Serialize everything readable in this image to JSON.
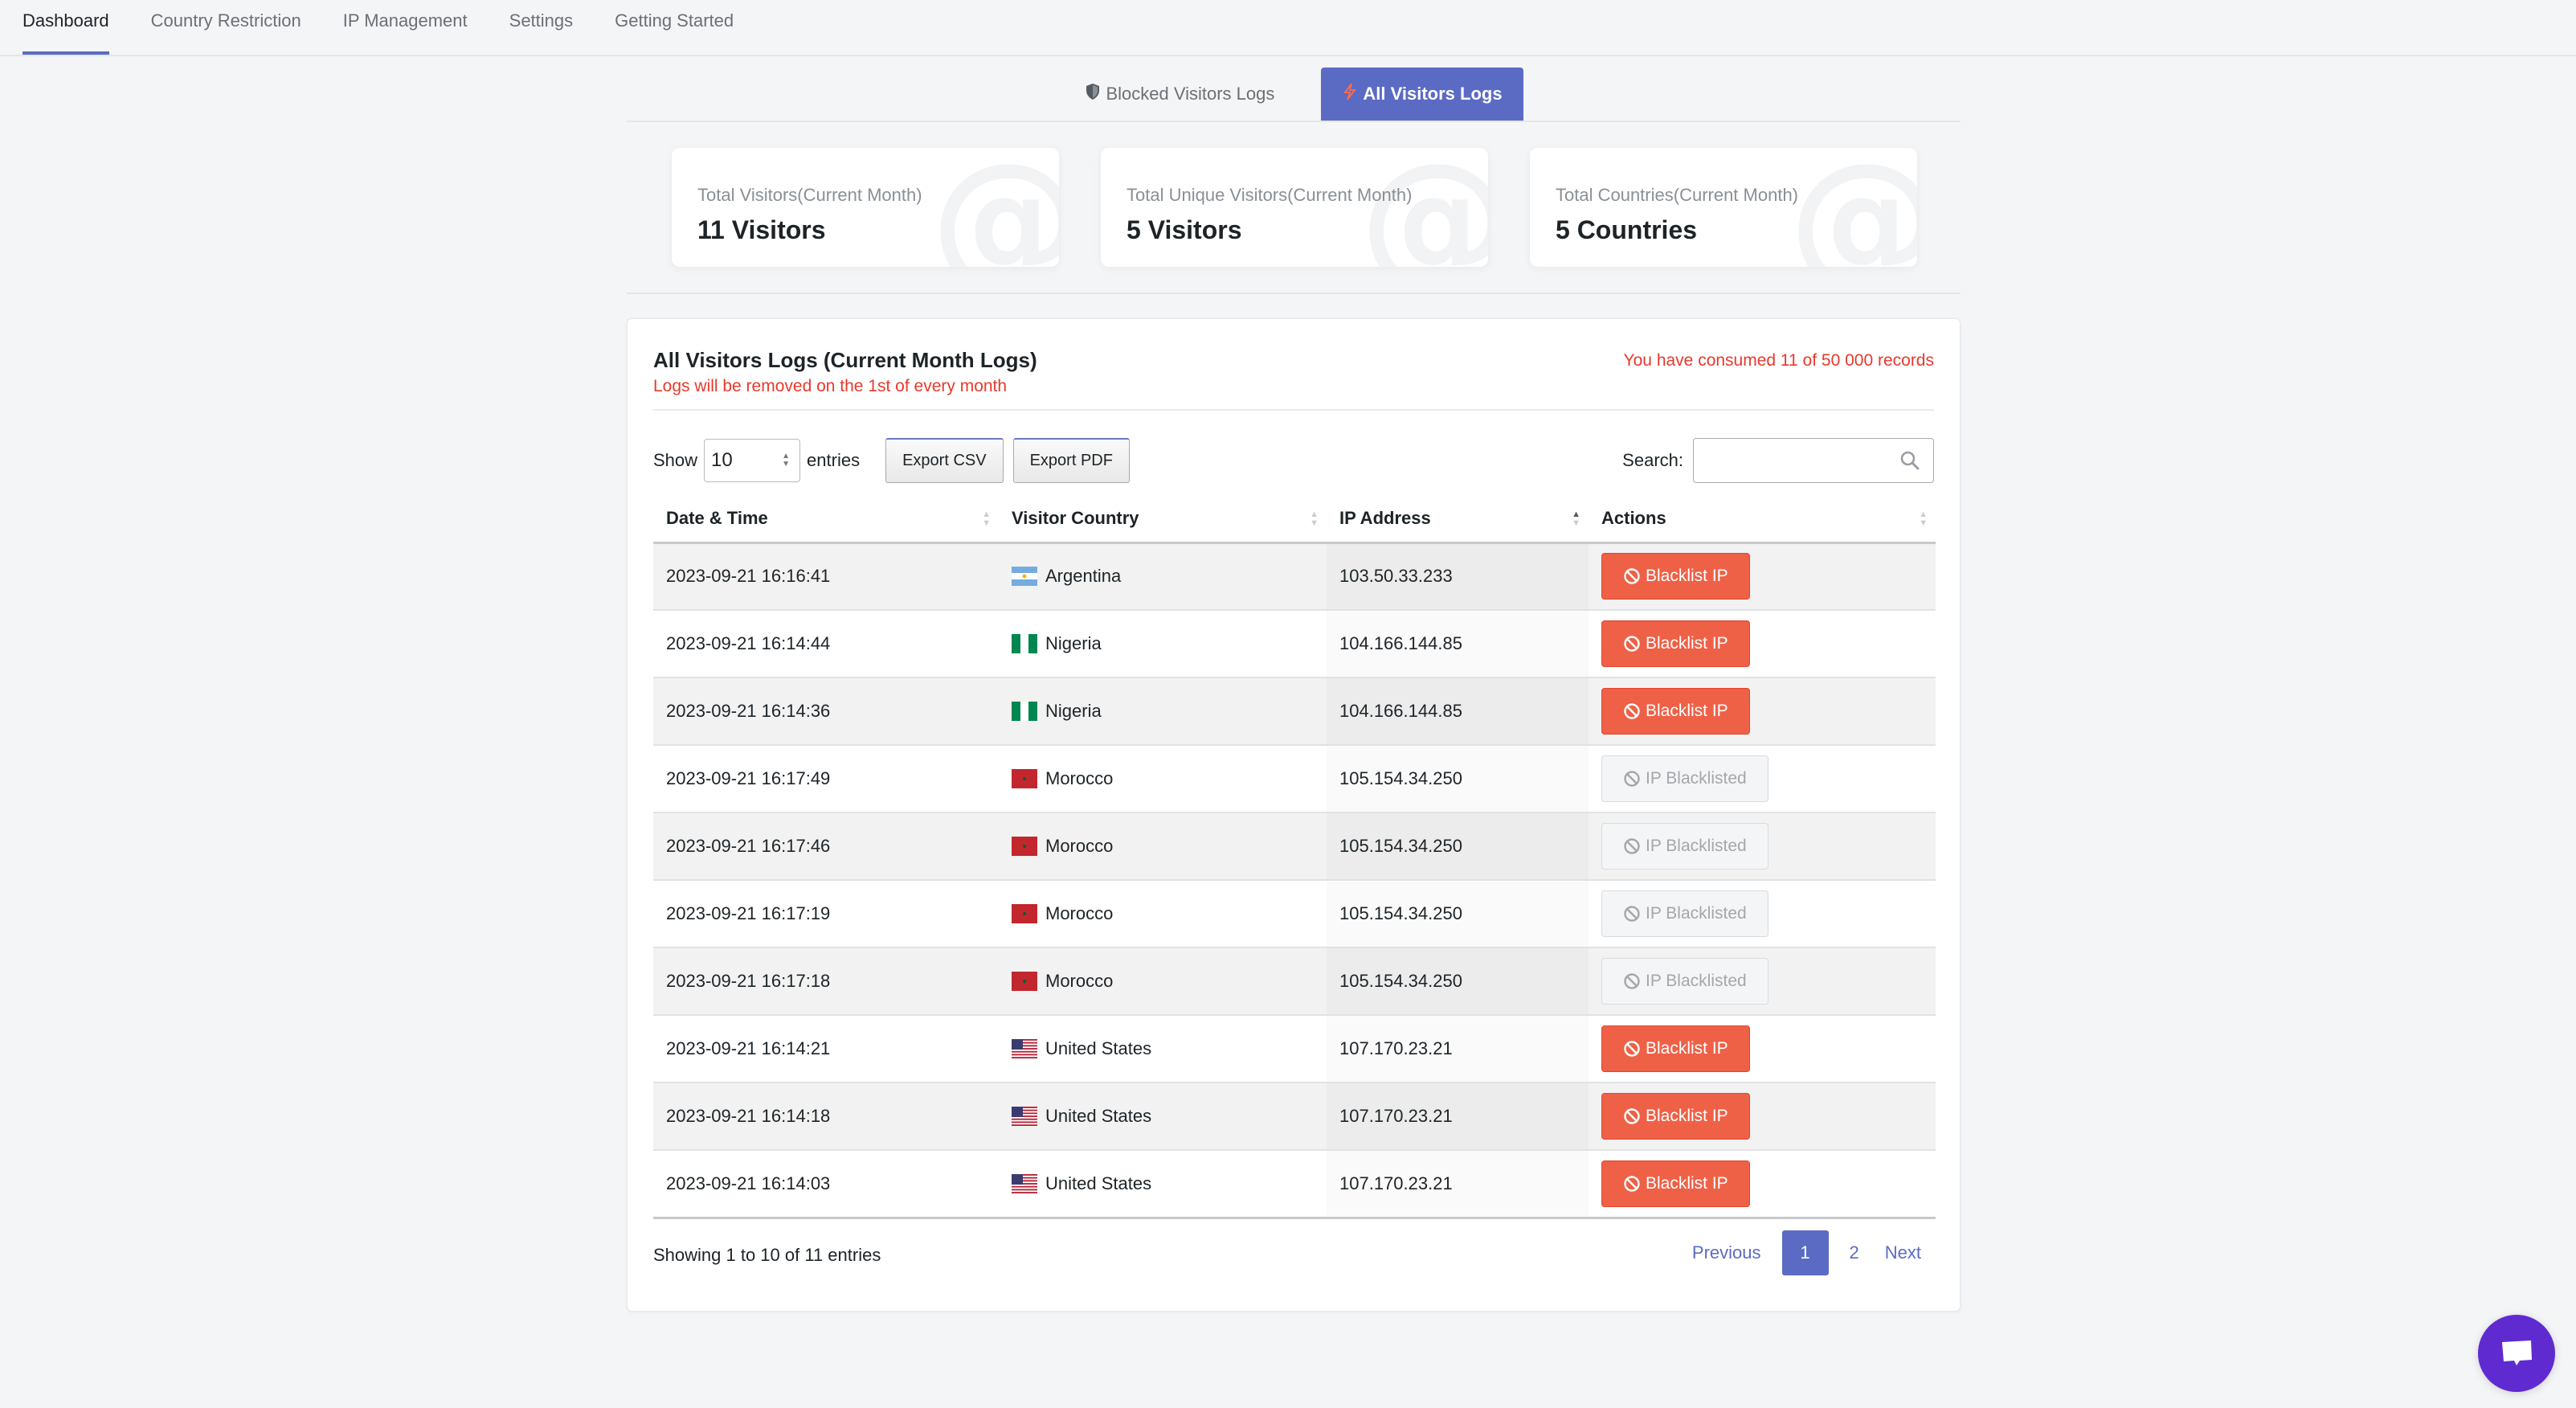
{
  "nav": {
    "items": [
      {
        "label": "Dashboard",
        "active": true
      },
      {
        "label": "Country Restriction",
        "active": false
      },
      {
        "label": "IP Management",
        "active": false
      },
      {
        "label": "Settings",
        "active": false
      },
      {
        "label": "Getting Started",
        "active": false
      }
    ]
  },
  "subtabs": {
    "blocked": {
      "label": "Blocked Visitors Logs",
      "icon": "shield-icon"
    },
    "all": {
      "label": "All Visitors Logs",
      "icon": "bolt-icon",
      "active": true
    }
  },
  "stats": [
    {
      "label": "Total Visitors(Current Month)",
      "value": "11 Visitors",
      "icon": "at-icon"
    },
    {
      "label": "Total Unique Visitors(Current Month)",
      "value": "5 Visitors",
      "icon": "at-icon"
    },
    {
      "label": "Total Countries(Current Month)",
      "value": "5 Countries",
      "icon": "at-icon"
    }
  ],
  "panel": {
    "title": "All Visitors Logs (Current Month Logs)",
    "subtitle": "Logs will be removed on the 1st of every month",
    "consumed": "You have consumed 11 of 50 000 records",
    "show_label": "Show",
    "entries_label": "entries",
    "page_length": "10",
    "export_csv": "Export CSV",
    "export_pdf": "Export PDF",
    "search_label": "Search:",
    "search_value": "",
    "colors": {
      "accent": "#5b6bc4",
      "danger": "#ee6147",
      "warning_text": "#e8392b"
    }
  },
  "table": {
    "columns": [
      {
        "label": "Date & Time",
        "sort": "none"
      },
      {
        "label": "Visitor Country",
        "sort": "none"
      },
      {
        "label": "IP Address",
        "sort": "asc"
      },
      {
        "label": "Actions",
        "sort": "none"
      }
    ],
    "rows": [
      {
        "datetime": "2023-09-21 16:16:41",
        "country": "Argentina",
        "flag": "ar",
        "ip": "103.50.33.233",
        "action": "Blacklist IP",
        "blacklisted": false
      },
      {
        "datetime": "2023-09-21 16:14:44",
        "country": "Nigeria",
        "flag": "ng",
        "ip": "104.166.144.85",
        "action": "Blacklist IP",
        "blacklisted": false
      },
      {
        "datetime": "2023-09-21 16:14:36",
        "country": "Nigeria",
        "flag": "ng",
        "ip": "104.166.144.85",
        "action": "Blacklist IP",
        "blacklisted": false
      },
      {
        "datetime": "2023-09-21 16:17:49",
        "country": "Morocco",
        "flag": "ma",
        "ip": "105.154.34.250",
        "action": "IP Blacklisted",
        "blacklisted": true
      },
      {
        "datetime": "2023-09-21 16:17:46",
        "country": "Morocco",
        "flag": "ma",
        "ip": "105.154.34.250",
        "action": "IP Blacklisted",
        "blacklisted": true
      },
      {
        "datetime": "2023-09-21 16:17:19",
        "country": "Morocco",
        "flag": "ma",
        "ip": "105.154.34.250",
        "action": "IP Blacklisted",
        "blacklisted": true
      },
      {
        "datetime": "2023-09-21 16:17:18",
        "country": "Morocco",
        "flag": "ma",
        "ip": "105.154.34.250",
        "action": "IP Blacklisted",
        "blacklisted": true
      },
      {
        "datetime": "2023-09-21 16:14:21",
        "country": "United States",
        "flag": "us",
        "ip": "107.170.23.21",
        "action": "Blacklist IP",
        "blacklisted": false
      },
      {
        "datetime": "2023-09-21 16:14:18",
        "country": "United States",
        "flag": "us",
        "ip": "107.170.23.21",
        "action": "Blacklist IP",
        "blacklisted": false
      },
      {
        "datetime": "2023-09-21 16:14:03",
        "country": "United States",
        "flag": "us",
        "ip": "107.170.23.21",
        "action": "Blacklist IP",
        "blacklisted": false
      }
    ]
  },
  "footer": {
    "info": "Showing 1 to 10 of 11 entries",
    "previous": "Previous",
    "pages": [
      "1",
      "2"
    ],
    "current_page": "1",
    "next": "Next"
  },
  "chat": {
    "icon": "chat-icon"
  }
}
